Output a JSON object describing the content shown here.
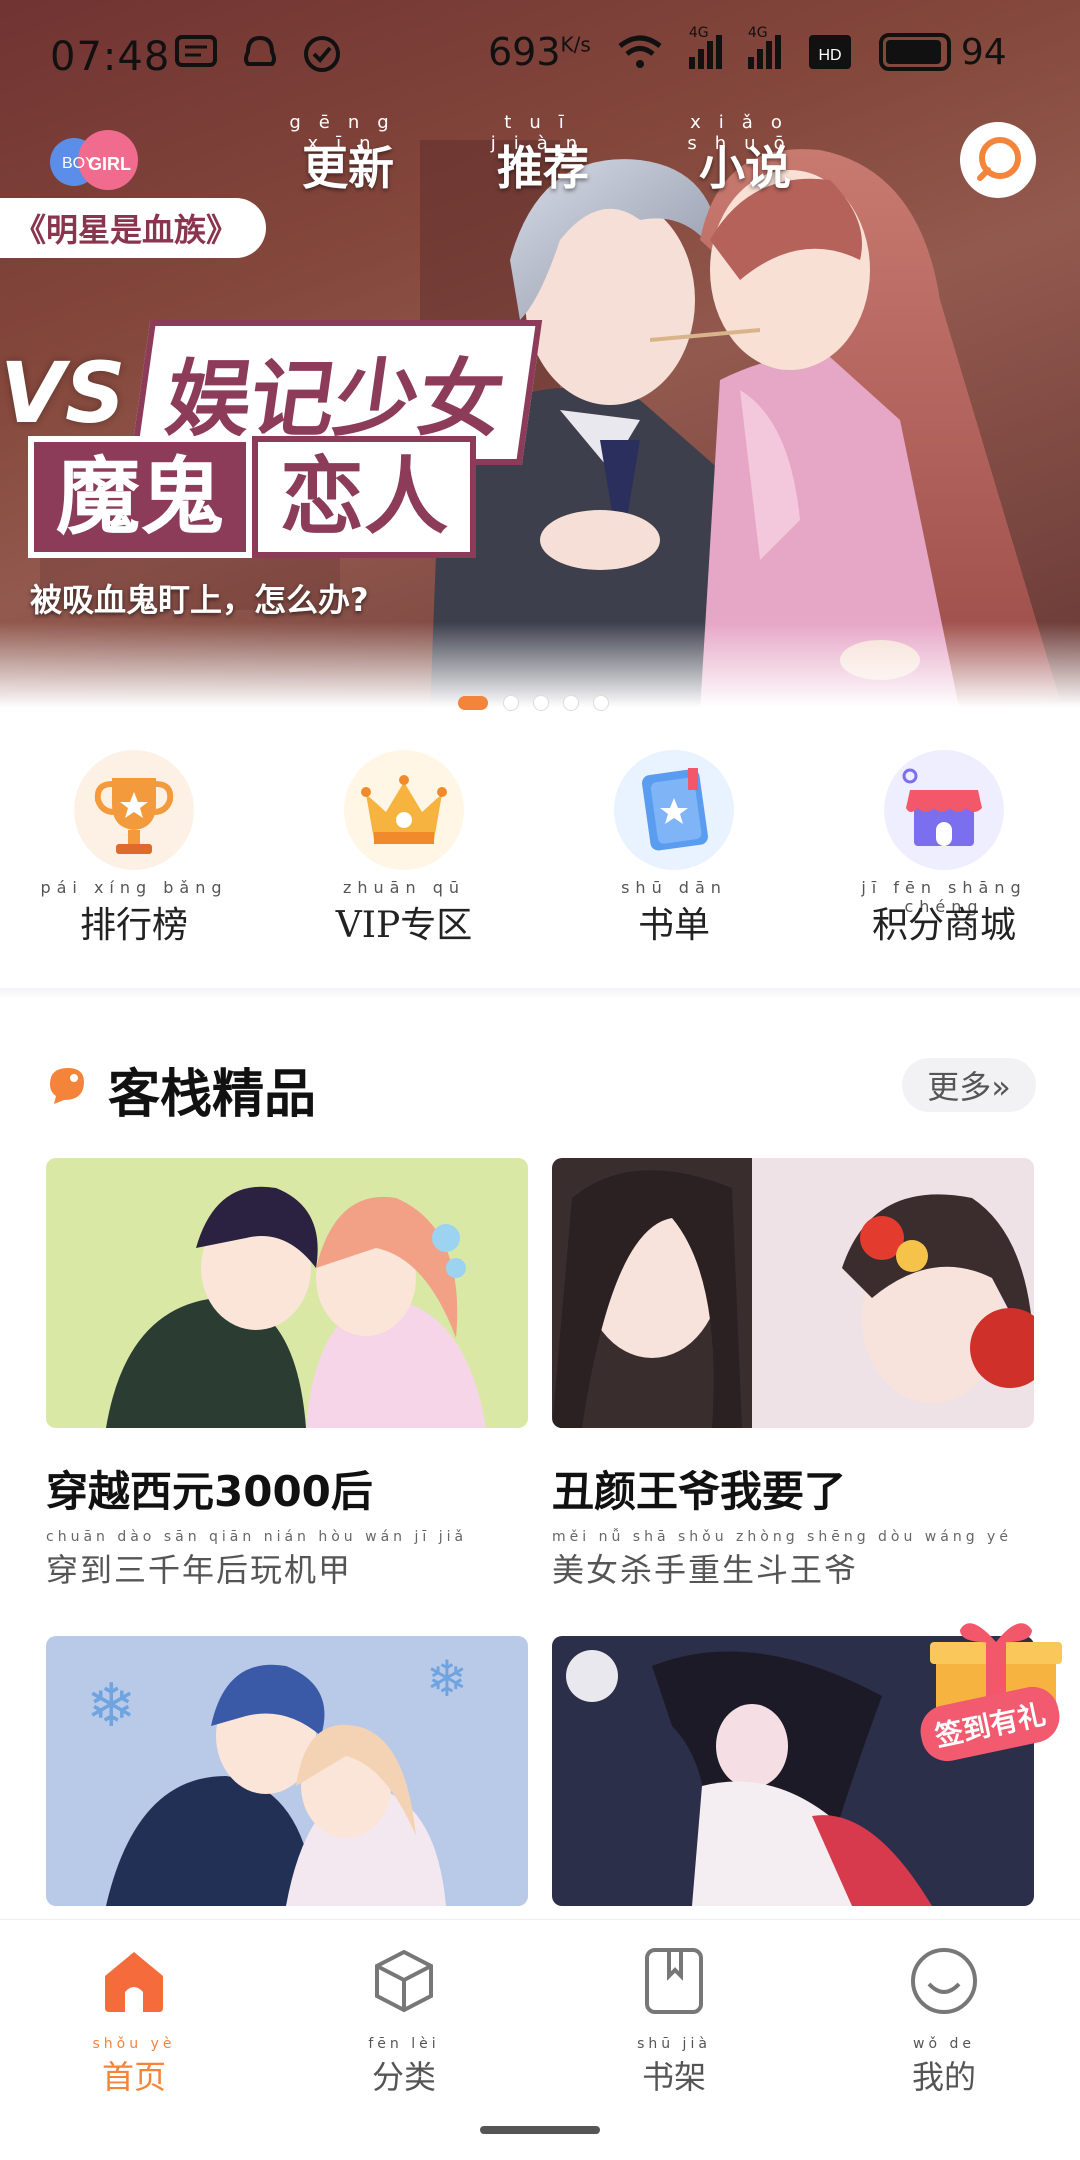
{
  "status_bar": {
    "time": "07:48",
    "speed": "693",
    "speed_unit": "K/s",
    "network_1": "4G",
    "network_2": "4G",
    "battery": "94",
    "icons": [
      "message-icon",
      "qq-icon",
      "check-circle-icon",
      "wifi-icon",
      "signal-icon",
      "signal-icon",
      "hd-icon",
      "battery-icon"
    ]
  },
  "top_nav": {
    "logo_text_boy": "BOY",
    "logo_text_girl": "GIRL",
    "tabs": [
      {
        "pinyin": "gēng xīn",
        "label": "更新"
      },
      {
        "pinyin": "tuī jiàn",
        "label": "推荐"
      },
      {
        "pinyin": "xiǎo shuō",
        "label": "小说"
      }
    ]
  },
  "banner": {
    "title": "《明星是血族》",
    "vs": "VS",
    "line1": "娱记少女",
    "line2a": "魔鬼",
    "line2b": "恋人",
    "subtitle": "被吸血鬼盯上，怎么办?",
    "dots": 5,
    "active_dot": 0
  },
  "quick_entries": [
    {
      "pinyin": "pái xíng bǎng",
      "label": "排行榜",
      "icon": "trophy-icon"
    },
    {
      "pinyin": "zhuān qū",
      "label": "VIP专区",
      "icon": "crown-icon"
    },
    {
      "pinyin": "shū dān",
      "label": "书单",
      "icon": "book-icon"
    },
    {
      "pinyin": "jī fēn shāng chéng",
      "label": "积分商城",
      "icon": "store-icon"
    }
  ],
  "section": {
    "title": "客栈精品",
    "more": "更多»"
  },
  "cards": [
    {
      "title": "穿越西元3000后",
      "sub_pinyin": "chuān dào sān qiān nián hòu wán jī jiǎ",
      "sub": "穿到三千年后玩机甲"
    },
    {
      "title": "丑颜王爷我要了",
      "sub_pinyin": "měi nǚ shā shǒu zhòng shēng dòu wáng yé",
      "sub": "美女杀手重生斗王爷"
    },
    {
      "title": "",
      "sub_pinyin": "",
      "sub": ""
    },
    {
      "title": "",
      "sub_pinyin": "",
      "sub": ""
    }
  ],
  "gift": {
    "label": "签到有礼"
  },
  "bottom_nav": [
    {
      "pinyin": "shǒu yè",
      "label": "首页",
      "icon": "home-icon",
      "active": true
    },
    {
      "pinyin": "fēn lèi",
      "label": "分类",
      "icon": "cube-icon",
      "active": false
    },
    {
      "pinyin": "shū jià",
      "label": "书架",
      "icon": "bookshelf-icon",
      "active": false
    },
    {
      "pinyin": "wǒ de",
      "label": "我的",
      "icon": "smile-icon",
      "active": false
    }
  ],
  "colors": {
    "accent": "#f5843b",
    "banner_plate": "#8c3b59",
    "gift_label": "#f25a6f"
  }
}
